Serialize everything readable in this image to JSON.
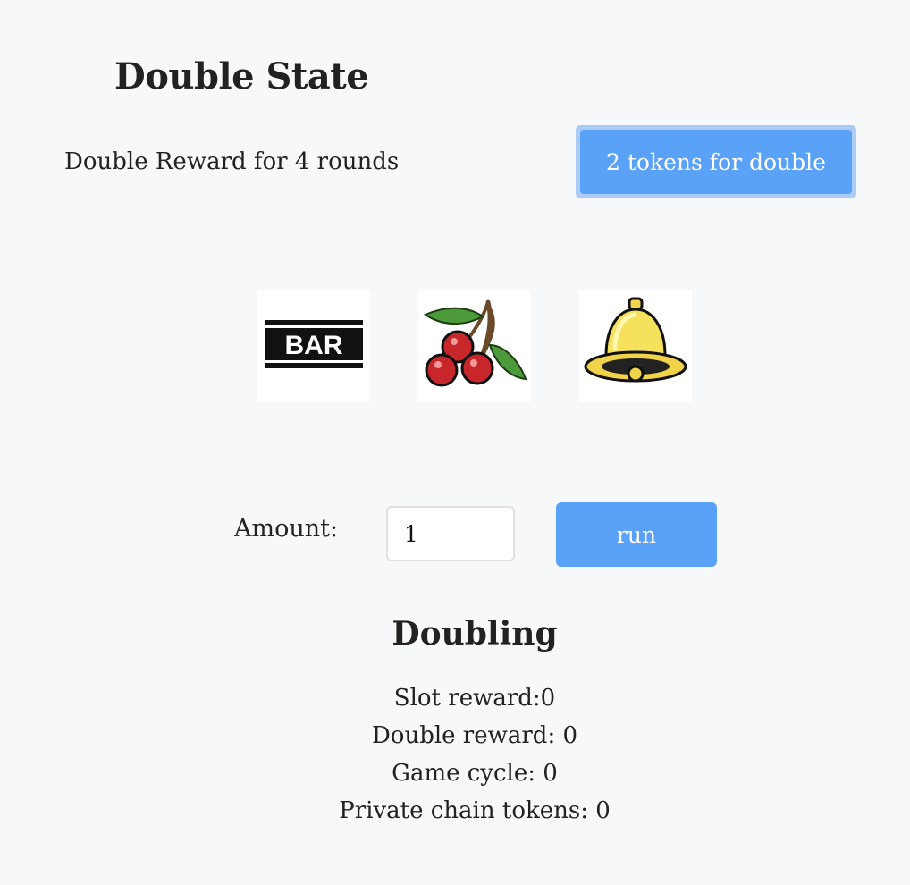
{
  "header": {
    "title": "Double State"
  },
  "double": {
    "reward_text": "Double Reward for 4 rounds",
    "button_label": "2 tokens for double"
  },
  "reels": [
    {
      "symbol": "bar-icon",
      "label": "BAR"
    },
    {
      "symbol": "cherry-icon"
    },
    {
      "symbol": "bell-icon"
    }
  ],
  "controls": {
    "amount_label": "Amount:",
    "amount_value": "1",
    "run_label": "run"
  },
  "doubling": {
    "title": "Doubling",
    "slot_reward": "Slot reward:0",
    "double_reward": "Double reward: 0",
    "game_cycle": "Game cycle: 0",
    "private_chain_tokens": "Private chain tokens: 0"
  },
  "colors": {
    "background": "#f7f8fa",
    "button_blue": "#5aa2f8",
    "focus_ring": "#a9cbf5",
    "text": "#222222"
  }
}
